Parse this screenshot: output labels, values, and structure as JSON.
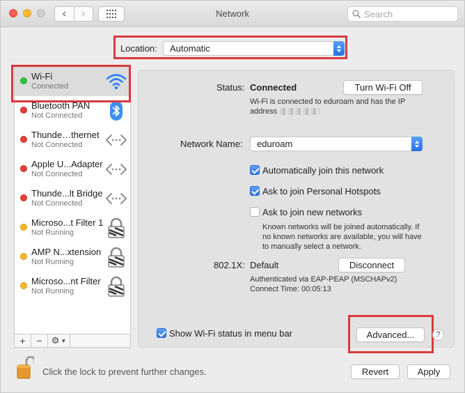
{
  "window": {
    "title": "Network"
  },
  "search": {
    "placeholder": "Search"
  },
  "location": {
    "label": "Location:",
    "value": "Automatic"
  },
  "services": [
    {
      "name": "Wi-Fi",
      "status": "Connected",
      "dot": "green",
      "icon": "wifi-icon",
      "selected": true
    },
    {
      "name": "Bluetooth PAN",
      "status": "Not Connected",
      "dot": "red",
      "icon": "bluetooth-icon"
    },
    {
      "name": "Thunde…thernet",
      "status": "Not Connected",
      "dot": "red",
      "icon": "ethernet-arrows-icon"
    },
    {
      "name": "Apple U...Adapter",
      "status": "Not Connected",
      "dot": "red",
      "icon": "ethernet-arrows-icon"
    },
    {
      "name": "Thunde...lt Bridge",
      "status": "Not Connected",
      "dot": "red",
      "icon": "ethernet-arrows-icon"
    },
    {
      "name": "Microso...t Filter 1",
      "status": "Not Running",
      "dot": "yellow",
      "icon": "vpn-lock-icon"
    },
    {
      "name": "AMP N...xtension",
      "status": "Not Running",
      "dot": "yellow",
      "icon": "vpn-lock-icon"
    },
    {
      "name": "Microso...nt Filter",
      "status": "Not Running",
      "dot": "yellow",
      "icon": "vpn-lock-icon"
    }
  ],
  "toolbar": {
    "add": "+",
    "remove": "−",
    "gear": "⚙"
  },
  "detail": {
    "status_label": "Status:",
    "status_value": "Connected",
    "turn_off_button": "Turn Wi-Fi Off",
    "status_desc_line1": "Wi-Fi is connected to eduroam and has the IP",
    "status_desc_line2": "address",
    "network_name_label": "Network Name:",
    "network_name_value": "eduroam",
    "auto_join_label": "Automatically join this network",
    "auto_join_checked": true,
    "hotspots_label": "Ask to join Personal Hotspots",
    "hotspots_checked": true,
    "new_networks_label": "Ask to join new networks",
    "new_networks_checked": false,
    "known_note_line1": "Known networks will be joined automatically. If",
    "known_note_line2": "no known networks are available, you will have",
    "known_note_line3": "to manually select a network.",
    "dot1x_label": "802.1X:",
    "dot1x_value": "Default",
    "disconnect_button": "Disconnect",
    "auth_line": "Authenticated via EAP-PEAP (MSCHAPv2)",
    "connect_time": "Connect Time: 00:05:13",
    "show_status_label": "Show Wi-Fi status in menu bar",
    "show_status_checked": true,
    "advanced_button": "Advanced...",
    "help_button": "?"
  },
  "footer": {
    "lock_text": "Click the lock to prevent further changes.",
    "revert_button": "Revert",
    "apply_button": "Apply"
  },
  "colors": {
    "highlight": "#d9393f",
    "accent": "#2f73e2",
    "connected": "#2ec840",
    "not_connected": "#e6403b",
    "not_running": "#f3b92d"
  }
}
